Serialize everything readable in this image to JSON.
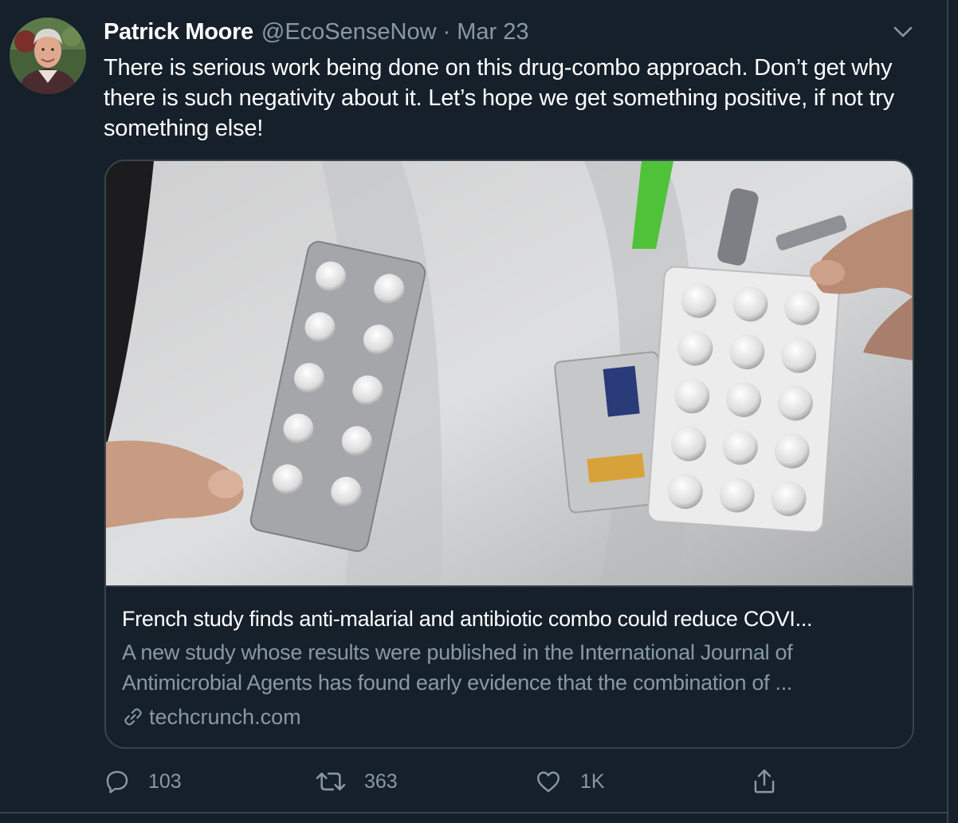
{
  "author": {
    "name": "Patrick Moore",
    "handle": "@EcoSenseNow",
    "separator": "·",
    "date": "Mar 23"
  },
  "tweet": {
    "text": "There is serious work being done on this drug-combo approach. Don’t get why there is such negativity about it. Let’s hope we get something positive, if not try something else!"
  },
  "card": {
    "title": "French study finds anti-malarial and antibiotic combo could reduce COVI...",
    "description": "A new study whose results were published in the International Journal of Antimicrobial Agents has found early evidence that the combination of ...",
    "domain": "techcrunch.com"
  },
  "actions": {
    "replies": "103",
    "retweets": "363",
    "likes": "1K"
  },
  "icons": {
    "caret": "chevron-down-icon",
    "link": "link-icon",
    "reply": "reply-icon",
    "retweet": "retweet-icon",
    "like": "heart-icon",
    "share": "share-icon"
  },
  "colors": {
    "background": "#15202b",
    "secondary_text": "#8899a6",
    "border": "#38444d"
  }
}
